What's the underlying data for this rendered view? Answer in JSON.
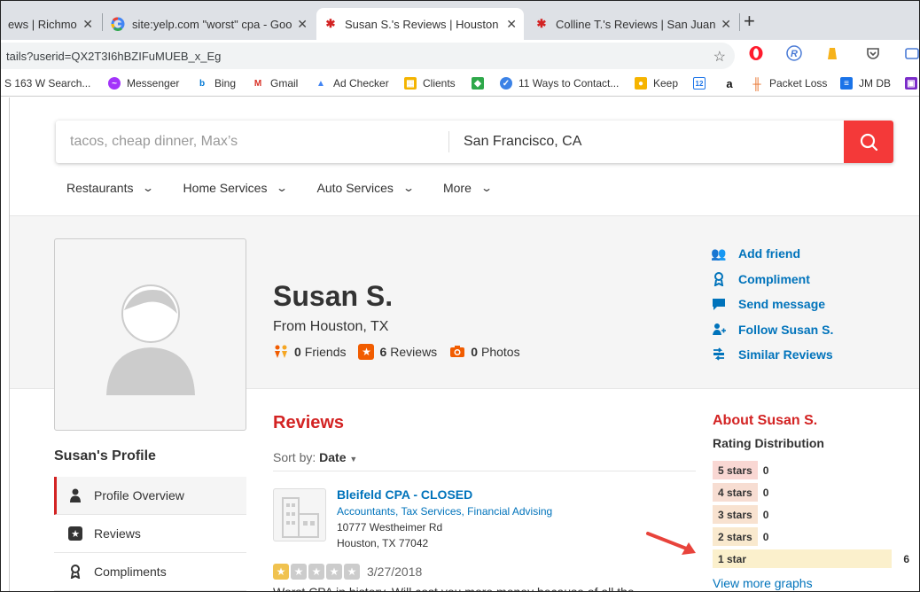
{
  "browser": {
    "tabs": [
      {
        "title": "ews | Richmon",
        "favicon": "yelp-icon"
      },
      {
        "title": "site:yelp.com \"worst\" cpa - Goog",
        "favicon": "google-icon"
      },
      {
        "title": "Susan S.'s Reviews | Houston - Ye",
        "favicon": "yelp-icon",
        "active": true
      },
      {
        "title": "Colline T.'s Reviews | San Juan - Y",
        "favicon": "yelp-icon"
      }
    ],
    "new_tab": "+",
    "url": "tails?userid=QX2T3I6hBZIFuMUEB_x_Eg",
    "bookmarks": [
      {
        "label": "S 163 W Search...",
        "icon": "page-icon"
      },
      {
        "label": "Messenger",
        "icon": "messenger-icon"
      },
      {
        "label": "Bing",
        "icon": "bing-icon"
      },
      {
        "label": "Gmail",
        "icon": "gmail-icon"
      },
      {
        "label": "Ad Checker",
        "icon": "ads-icon"
      },
      {
        "label": "Clients",
        "icon": "clients-icon"
      },
      {
        "label": "",
        "icon": "green-icon"
      },
      {
        "label": "11 Ways to Contact...",
        "icon": "check-icon"
      },
      {
        "label": "Keep",
        "icon": "keep-icon"
      },
      {
        "label": "",
        "icon": "calendar-icon"
      },
      {
        "label": "",
        "icon": "amazon-icon"
      },
      {
        "label": "Packet Loss",
        "icon": "packet-icon"
      },
      {
        "label": "JM DB",
        "icon": "sheets-icon"
      },
      {
        "label": "",
        "icon": "purple-icon"
      }
    ]
  },
  "search": {
    "find_placeholder": "tacos, cheap dinner, Max’s",
    "near_value": "San Francisco, CA"
  },
  "categories": [
    "Restaurants",
    "Home Services",
    "Auto Services",
    "More"
  ],
  "profile": {
    "name": "Susan S.",
    "from": "From Houston, TX",
    "friends_count": "0",
    "friends_label": "Friends",
    "reviews_count": "6",
    "reviews_label": "Reviews",
    "photos_count": "0",
    "photos_label": "Photos"
  },
  "actions": [
    "Add friend",
    "Compliment",
    "Send message",
    "Follow Susan S.",
    "Similar Reviews"
  ],
  "sidebar": {
    "heading": "Susan's Profile",
    "items": [
      "Profile Overview",
      "Reviews",
      "Compliments"
    ]
  },
  "reviews": {
    "heading": "Reviews",
    "sort_label": "Sort by:",
    "sort_value": "Date",
    "items": [
      {
        "business": "Bleifeld CPA - CLOSED",
        "categories": "Accountants, Tax Services, Financial Advising",
        "address1": "10777 Westheimer Rd",
        "address2": "Houston, TX 77042",
        "stars": 1,
        "date": "3/27/2018",
        "text": "Worst CPA in history. Will cost you more money because of all the"
      }
    ]
  },
  "about": {
    "heading": "About Susan S.",
    "dist_heading": "Rating Distribution",
    "distribution": [
      {
        "label": "5 stars",
        "count": "0",
        "color": "#f9d7d3"
      },
      {
        "label": "4 stars",
        "count": "0",
        "color": "#f7ddd2"
      },
      {
        "label": "3 stars",
        "count": "0",
        "color": "#f8e2d0"
      },
      {
        "label": "2 stars",
        "count": "0",
        "color": "#f9e9ce"
      },
      {
        "label": "1 star",
        "count": "6",
        "color": "#fbf0cc"
      }
    ],
    "more_link": "View more graphs"
  },
  "colors": {
    "yelp_red": "#d32323",
    "link_blue": "#0073bb",
    "search_red": "#f43939",
    "annotation_arrow": "#e8433b"
  }
}
